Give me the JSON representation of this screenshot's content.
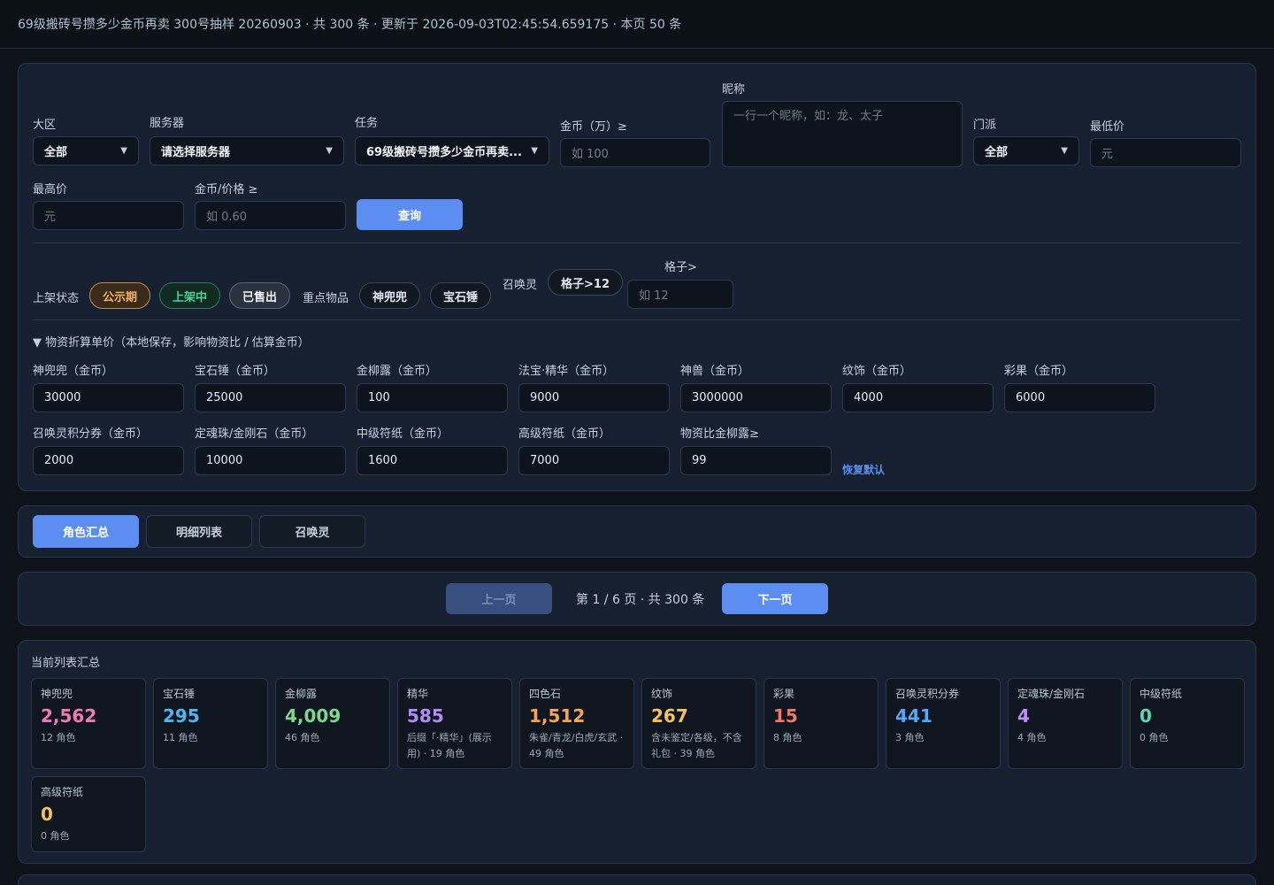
{
  "header": {
    "title": "69级搬砖号攒多少金币再卖 300号抽样 20260903 · 共 300 条 · 更新于 2026-09-03T02:45:54.659175 · 本页 50 条"
  },
  "filters": {
    "region_label": "大区",
    "region_value": "全部",
    "server_label": "服务器",
    "server_value": "请选择服务器",
    "task_label": "任务",
    "task_value": "69级搬砖号攒多少金币再卖...",
    "gold_label": "金币（万）≥",
    "gold_placeholder": "如 100",
    "nickname_label": "昵称",
    "nickname_placeholder": "一行一个昵称，如：龙、太子",
    "school_label": "门派",
    "school_value": "全部",
    "min_price_label": "最低价",
    "min_price_placeholder": "元",
    "max_price_label": "最高价",
    "max_price_placeholder": "元",
    "ratio_label": "金币/价格 ≥",
    "ratio_placeholder": "如 0.60",
    "query_button": "查询"
  },
  "status_row": {
    "status_label": "上架状态",
    "status_public": "公示期",
    "status_onsale": "上架中",
    "status_sold": "已售出",
    "key_items_label": "重点物品",
    "item1": "神兜兜",
    "item2": "宝石锤",
    "summon_label": "召唤灵",
    "slot_pill": "格子>12",
    "slot_label": "格子>",
    "slot_placeholder": "如 12"
  },
  "pricing": {
    "toggle_label": "▼ 物资折算单价（本地保存，影响物资比 / 估算金币）",
    "fields": [
      {
        "label": "神兜兜（金币）",
        "value": "30000"
      },
      {
        "label": "宝石锤（金币）",
        "value": "25000"
      },
      {
        "label": "金柳露（金币）",
        "value": "100"
      },
      {
        "label": "法宝·精华（金币）",
        "value": "9000"
      },
      {
        "label": "神兽（金币）",
        "value": "3000000"
      },
      {
        "label": "纹饰（金币）",
        "value": "4000"
      },
      {
        "label": "彩果（金币）",
        "value": "6000"
      },
      {
        "label": "召唤灵积分券（金币）",
        "value": "2000"
      },
      {
        "label": "定魂珠/金刚石（金币）",
        "value": "10000"
      },
      {
        "label": "中级符纸（金币）",
        "value": "1600"
      },
      {
        "label": "高级符纸（金币）",
        "value": "7000"
      },
      {
        "label": "物资比金柳露≥",
        "value": "99"
      }
    ],
    "reset_link": "恢复默认"
  },
  "tabs": [
    "角色汇总",
    "明细列表",
    "召唤灵"
  ],
  "pagination": {
    "prev": "上一页",
    "info": "第 1 / 6 页 · 共 300 条",
    "next": "下一页"
  },
  "summary": {
    "title": "当前列表汇总",
    "stats": [
      {
        "title": "神兜兜",
        "value": "2,562",
        "sub": "12 角色",
        "color": "#f07ab8"
      },
      {
        "title": "宝石锤",
        "value": "295",
        "sub": "11 角色",
        "color": "#4fb6f0"
      },
      {
        "title": "金柳露",
        "value": "4,009",
        "sub": "46 角色",
        "color": "#7bd88f"
      },
      {
        "title": "精华",
        "value": "585",
        "sub": "后缀「·精华」(展示用) · 19 角色",
        "color": "#b28cf5"
      },
      {
        "title": "四色石",
        "value": "1,512",
        "sub": "朱雀/青龙/白虎/玄武 · 49 角色",
        "color": "#f5a55a"
      },
      {
        "title": "纹饰",
        "value": "267",
        "sub": "含未鉴定/各级，不含礼包 · 39 角色",
        "color": "#f5c25a"
      },
      {
        "title": "彩果",
        "value": "15",
        "sub": "8 角色",
        "color": "#f07a6a"
      },
      {
        "title": "召唤灵积分券",
        "value": "441",
        "sub": "3 角色",
        "color": "#5aa7f5"
      },
      {
        "title": "定魂珠/金刚石",
        "value": "4",
        "sub": "4 角色",
        "color": "#c48cf5"
      },
      {
        "title": "中级符纸",
        "value": "0",
        "sub": "0 角色",
        "color": "#5ad8b0"
      },
      {
        "title": "高级符纸",
        "value": "0",
        "sub": "0 角色",
        "color": "#f5c25a"
      }
    ]
  }
}
